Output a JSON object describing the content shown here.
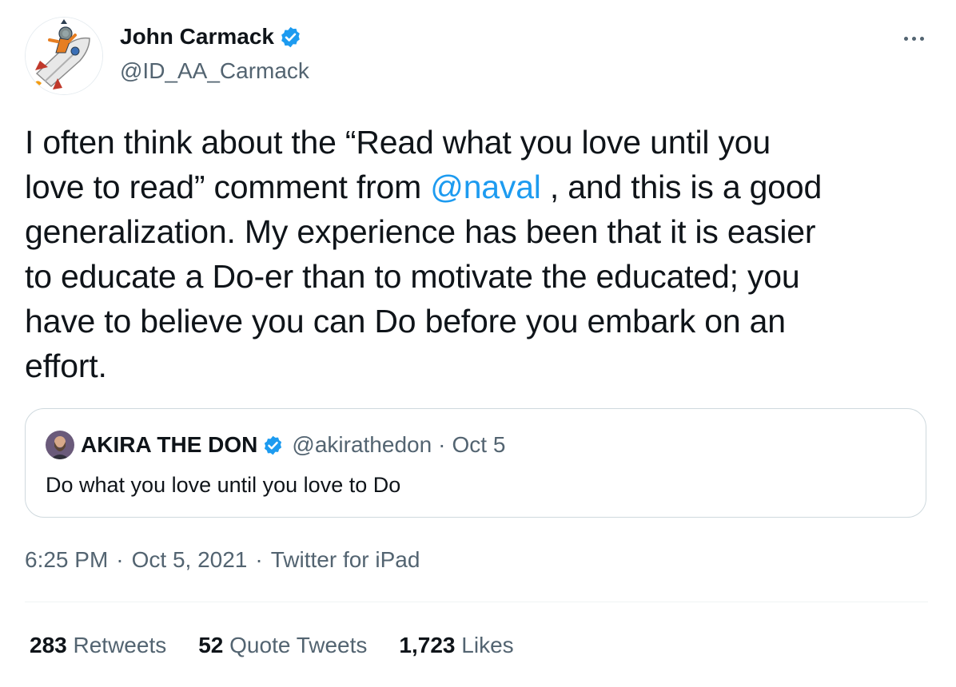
{
  "author": {
    "name": "John Carmack",
    "handle": "@ID_AA_Carmack",
    "verified_color": "#1d9bf0"
  },
  "tweet": {
    "lines": [
      [
        "I often think about the “Read what you love until you"
      ],
      [
        "love to read” comment from ",
        "@naval",
        " , and this is a good"
      ],
      [
        "generalization. My experience has been that it is easier"
      ],
      [
        "to educate a Do-er than to motivate the educated; you"
      ],
      [
        "have to believe you can Do before you embark on an"
      ],
      [
        "effort."
      ]
    ]
  },
  "quoted": {
    "name": "AKIRA THE DON",
    "handle": "@akirathedon",
    "separator": "·",
    "date": "Oct 5",
    "text": "Do what you love until you love to Do"
  },
  "meta": {
    "time": "6:25 PM",
    "date": "Oct 5, 2021",
    "source": "Twitter for iPad",
    "separator": "·"
  },
  "stats": {
    "retweets_count": "283",
    "retweets_label": "Retweets",
    "quotes_count": "52",
    "quotes_label": "Quote Tweets",
    "likes_count": "1,723",
    "likes_label": "Likes"
  },
  "colors": {
    "link": "#1d9bf0",
    "secondary_text": "#536471",
    "border": "#cfd9de"
  }
}
